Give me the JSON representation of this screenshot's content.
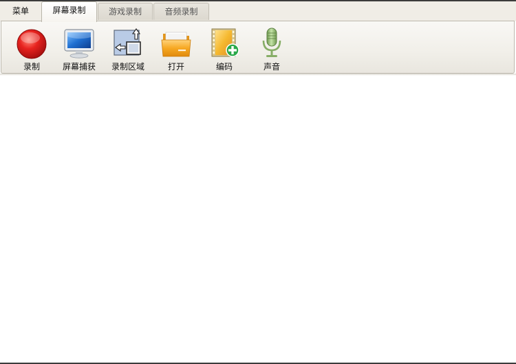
{
  "tabs": {
    "menu": "菜单",
    "screen_record": "屏幕录制",
    "game_record": "游戏录制",
    "audio_record": "音频录制"
  },
  "toolbar": {
    "items": [
      {
        "label": "录制",
        "icon": "record-icon"
      },
      {
        "label": "屏幕捕获",
        "icon": "monitor-icon"
      },
      {
        "label": "录制区域",
        "icon": "region-select-icon"
      },
      {
        "label": "打开",
        "icon": "folder-icon"
      },
      {
        "label": "编码",
        "icon": "film-add-icon"
      },
      {
        "label": "声音",
        "icon": "microphone-icon"
      }
    ]
  },
  "colors": {
    "tab_bar_bg": "#f0ede6",
    "ribbon_bg": "#f1efe9",
    "record_red": "#e02020",
    "monitor_blue": "#1f6fd1",
    "folder_orange": "#f5a31a",
    "plus_green": "#2aa84a",
    "mic_green": "#8fbf6a"
  }
}
